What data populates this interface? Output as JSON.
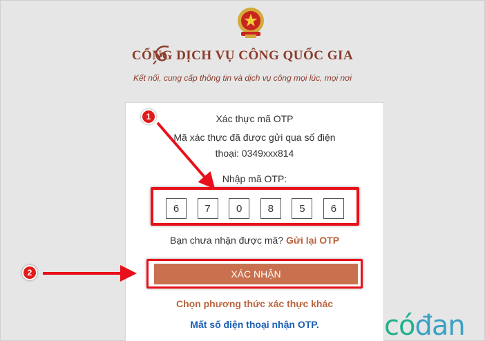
{
  "header": {
    "title": "CỔNG DỊCH VỤ CÔNG QUỐC GIA",
    "subtitle": "Kết nối, cung cấp thông tin và dịch vụ công mọi lúc, mọi nơi"
  },
  "otp": {
    "heading": "Xác thực mã OTP",
    "message": "Mã xác thực đã được gửi qua số điện thoại: 0349xxx814",
    "input_label": "Nhập mã OTP:",
    "digits": [
      "6",
      "7",
      "0",
      "8",
      "5",
      "6"
    ],
    "resend_prompt": "Bạn chưa nhận được mã?",
    "resend_link": "Gửi lại OTP",
    "confirm_button": "XÁC NHẬN",
    "alt_method_link": "Chọn phương thức xác thực khác",
    "lost_phone_link": "Mất số điện thoại nhận OTP."
  },
  "annotations": {
    "step_1": "1",
    "step_2": "2",
    "highlight_color": "#e8101a"
  },
  "watermark": {
    "part1": "có",
    "part2": "đan"
  },
  "colors": {
    "brand": "#8a3b2a",
    "button": "#c9714f",
    "link_orange": "#b9633e",
    "link_blue": "#1a5fb4"
  }
}
